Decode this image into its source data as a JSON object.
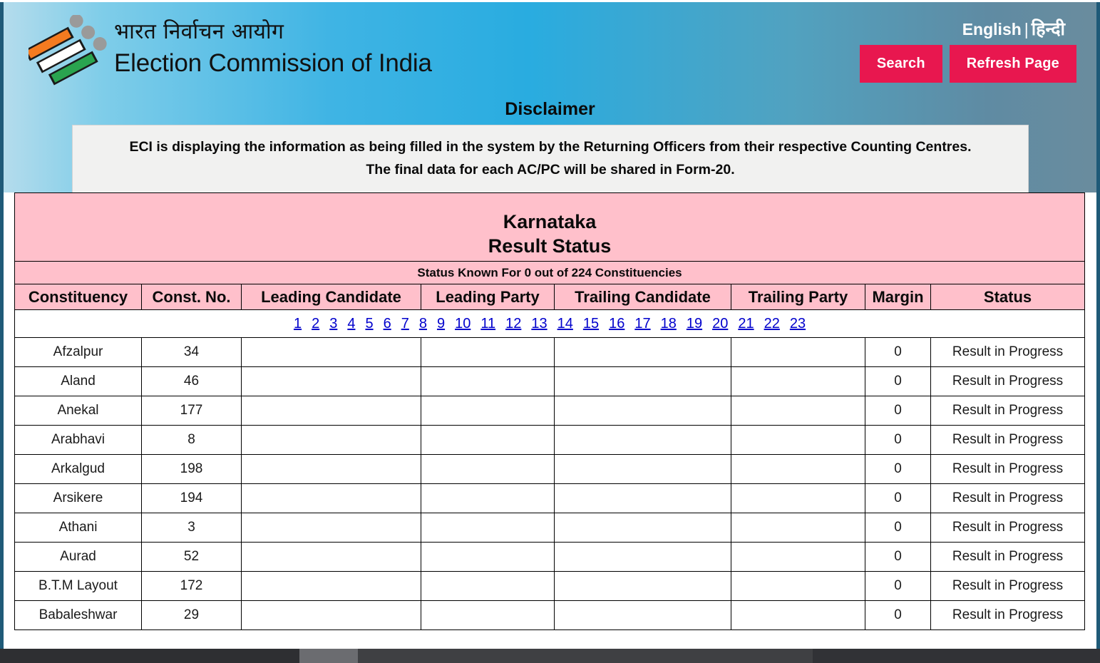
{
  "header": {
    "logo_alt": "eci-logo",
    "org_name_hindi": "भारत निर्वाचन आयोग",
    "org_name_english": "Election Commission of India",
    "lang_english": "English",
    "lang_separator": "|",
    "lang_hindi": "हिन्दी",
    "search_label": "Search",
    "refresh_label": "Refresh Page",
    "button_color": "#e8174f",
    "gradient_start": "#b4dcec",
    "gradient_mid": "#29ace0",
    "gradient_end": "#6a8c9e"
  },
  "disclaimer": {
    "title": "Disclaimer",
    "line1": "ECI is displaying the information as being filled in the system by the Returning Officers from their respective Counting Centres.",
    "line2": "The final data for each AC/PC will be shared in Form-20."
  },
  "result_panel": {
    "state": "Karnataka",
    "subtitle": "Result Status",
    "status_known": "Status Known For 0 out of 224 Constituencies",
    "header_bg": "#ffc0cb",
    "columns": [
      "Constituency",
      "Const. No.",
      "Leading Candidate",
      "Leading Party",
      "Trailing Candidate",
      "Trailing Party",
      "Margin",
      "Status"
    ],
    "pagination": [
      "1",
      "2",
      "3",
      "4",
      "5",
      "6",
      "7",
      "8",
      "9",
      "10",
      "11",
      "12",
      "13",
      "14",
      "15",
      "16",
      "17",
      "18",
      "19",
      "20",
      "21",
      "22",
      "23"
    ],
    "pagination_link_color": "#0000cc",
    "rows": [
      {
        "constituency": "Afzalpur",
        "const_no": "34",
        "leading_candidate": "",
        "leading_party": "",
        "trailing_candidate": "",
        "trailing_party": "",
        "margin": "0",
        "status": "Result in Progress"
      },
      {
        "constituency": "Aland",
        "const_no": "46",
        "leading_candidate": "",
        "leading_party": "",
        "trailing_candidate": "",
        "trailing_party": "",
        "margin": "0",
        "status": "Result in Progress"
      },
      {
        "constituency": "Anekal",
        "const_no": "177",
        "leading_candidate": "",
        "leading_party": "",
        "trailing_candidate": "",
        "trailing_party": "",
        "margin": "0",
        "status": "Result in Progress"
      },
      {
        "constituency": "Arabhavi",
        "const_no": "8",
        "leading_candidate": "",
        "leading_party": "",
        "trailing_candidate": "",
        "trailing_party": "",
        "margin": "0",
        "status": "Result in Progress"
      },
      {
        "constituency": "Arkalgud",
        "const_no": "198",
        "leading_candidate": "",
        "leading_party": "",
        "trailing_candidate": "",
        "trailing_party": "",
        "margin": "0",
        "status": "Result in Progress"
      },
      {
        "constituency": "Arsikere",
        "const_no": "194",
        "leading_candidate": "",
        "leading_party": "",
        "trailing_candidate": "",
        "trailing_party": "",
        "margin": "0",
        "status": "Result in Progress"
      },
      {
        "constituency": "Athani",
        "const_no": "3",
        "leading_candidate": "",
        "leading_party": "",
        "trailing_candidate": "",
        "trailing_party": "",
        "margin": "0",
        "status": "Result in Progress"
      },
      {
        "constituency": "Aurad",
        "const_no": "52",
        "leading_candidate": "",
        "leading_party": "",
        "trailing_candidate": "",
        "trailing_party": "",
        "margin": "0",
        "status": "Result in Progress"
      },
      {
        "constituency": "B.T.M Layout",
        "const_no": "172",
        "leading_candidate": "",
        "leading_party": "",
        "trailing_candidate": "",
        "trailing_party": "",
        "margin": "0",
        "status": "Result in Progress"
      },
      {
        "constituency": "Babaleshwar",
        "const_no": "29",
        "leading_candidate": "",
        "leading_party": "",
        "trailing_candidate": "",
        "trailing_party": "",
        "margin": "0",
        "status": "Result in Progress"
      }
    ]
  }
}
